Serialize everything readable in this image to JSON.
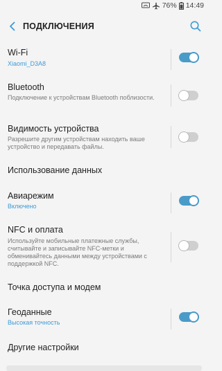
{
  "status_bar": {
    "battery": "76%",
    "time": "14:49",
    "icons": [
      "screen-mirror-icon",
      "airplane-icon",
      "battery-icon"
    ]
  },
  "header": {
    "title": "ПОДКЛЮЧЕНИЯ",
    "back_icon": "chevron-left-icon",
    "search_icon": "search-icon"
  },
  "settings": {
    "wifi": {
      "label": "Wi-Fi",
      "sub": "Xiaomi_D3A8",
      "enabled": true
    },
    "bluetooth": {
      "label": "Bluetooth",
      "sub": "Подключение к устройствам Bluetooth поблизости.",
      "enabled": false
    },
    "visibility": {
      "label": "Видимость устройства",
      "sub": "Разрешите другим устройствам находить ваше устройство и передавать файлы.",
      "enabled": false
    },
    "data_usage": {
      "label": "Использование данных"
    },
    "airplane": {
      "label": "Авиарежим",
      "sub": "Включено",
      "enabled": true
    },
    "nfc": {
      "label": "NFC и оплата",
      "sub": "Используйте мобильные платежные службы, считывайте и записывайте NFC-метки и обменивайтесь данными между устройствами с поддержкой NFC.",
      "enabled": false
    },
    "hotspot": {
      "label": "Точка доступа и модем"
    },
    "location": {
      "label": "Геоданные",
      "sub": "Высокая точность",
      "enabled": true
    },
    "more": {
      "label": "Другие настройки"
    }
  },
  "colors": {
    "accent": "#3c9bd6",
    "toggle_on": "#4a9bc8",
    "toggle_off": "#cfcfcf",
    "background": "#f4f4f4"
  }
}
